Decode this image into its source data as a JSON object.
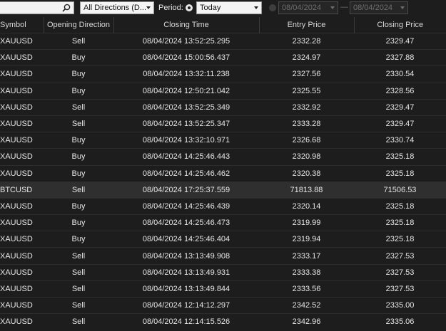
{
  "toolbar": {
    "search_value": "",
    "direction_value": "All Directions (D...",
    "period_label": "Period:",
    "period_value": "Today",
    "date_from": "08/04/2024",
    "date_to": "08/04/2024",
    "date_separator": "—"
  },
  "table": {
    "columns": [
      "Symbol",
      "Opening Direction",
      "Closing Time",
      "Entry Price",
      "Closing Price"
    ],
    "rows": [
      [
        "XAUUSD",
        "Sell",
        "08/04/2024 13:52:25.295",
        "2332.28",
        "2329.47"
      ],
      [
        "XAUUSD",
        "Buy",
        "08/04/2024 15:00:56.437",
        "2324.97",
        "2327.88"
      ],
      [
        "XAUUSD",
        "Buy",
        "08/04/2024 13:32:11.238",
        "2327.56",
        "2330.54"
      ],
      [
        "XAUUSD",
        "Buy",
        "08/04/2024 12:50:21.042",
        "2325.55",
        "2328.56"
      ],
      [
        "XAUUSD",
        "Sell",
        "08/04/2024 13:52:25.349",
        "2332.92",
        "2329.47"
      ],
      [
        "XAUUSD",
        "Sell",
        "08/04/2024 13:52:25.347",
        "2333.28",
        "2329.47"
      ],
      [
        "XAUUSD",
        "Buy",
        "08/04/2024 13:32:10.971",
        "2326.68",
        "2330.74"
      ],
      [
        "XAUUSD",
        "Buy",
        "08/04/2024 14:25:46.443",
        "2320.98",
        "2325.18"
      ],
      [
        "XAUUSD",
        "Buy",
        "08/04/2024 14:25:46.462",
        "2320.38",
        "2325.18"
      ],
      [
        "BTCUSD",
        "Sell",
        "08/04/2024 17:25:37.559",
        "71813.88",
        "71506.53"
      ],
      [
        "XAUUSD",
        "Buy",
        "08/04/2024 14:25:46.439",
        "2320.14",
        "2325.18"
      ],
      [
        "XAUUSD",
        "Buy",
        "08/04/2024 14:25:46.473",
        "2319.99",
        "2325.18"
      ],
      [
        "XAUUSD",
        "Buy",
        "08/04/2024 14:25:46.404",
        "2319.94",
        "2325.18"
      ],
      [
        "XAUUSD",
        "Sell",
        "08/04/2024 13:13:49.908",
        "2333.17",
        "2327.53"
      ],
      [
        "XAUUSD",
        "Sell",
        "08/04/2024 13:13:49.931",
        "2333.38",
        "2327.53"
      ],
      [
        "XAUUSD",
        "Sell",
        "08/04/2024 13:13:49.844",
        "2333.56",
        "2327.53"
      ],
      [
        "XAUUSD",
        "Sell",
        "08/04/2024 12:14:12.297",
        "2342.52",
        "2335.00"
      ],
      [
        "XAUUSD",
        "Sell",
        "08/04/2024 12:14:15.526",
        "2342.96",
        "2335.06"
      ]
    ],
    "highlighted_row": 9
  },
  "colors": {
    "background": "#1d1d1d",
    "highlight_row": "#2f2f2f",
    "text": "#e6e6e6"
  }
}
